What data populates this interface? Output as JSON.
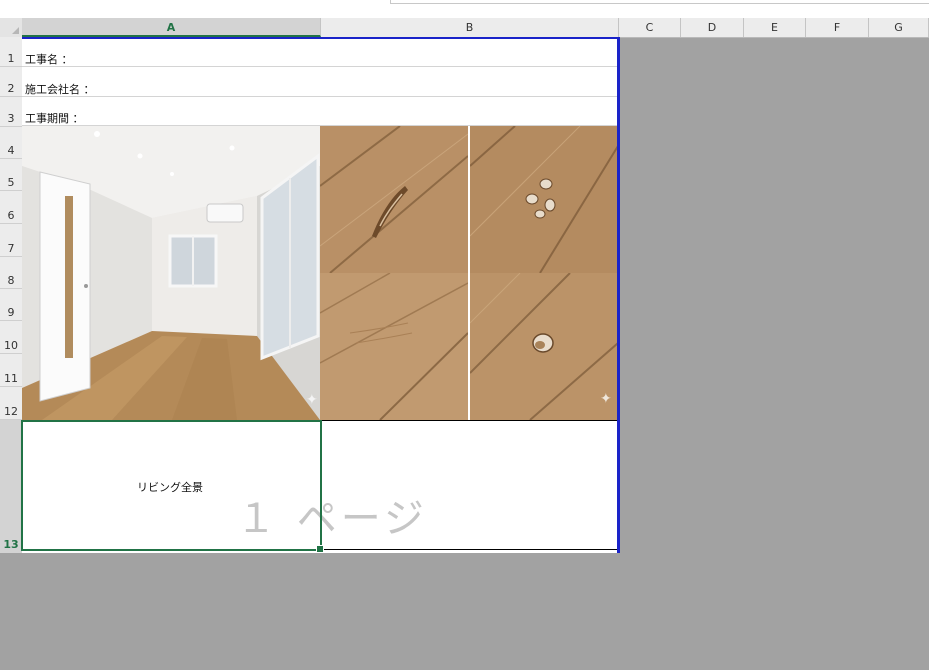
{
  "sheet": {
    "columns": [
      "A",
      "B",
      "C",
      "D",
      "E",
      "F",
      "G"
    ],
    "selected_column": "A",
    "rows": [
      "1",
      "2",
      "3",
      "4",
      "5",
      "6",
      "7",
      "8",
      "9",
      "10",
      "11",
      "12",
      "13"
    ],
    "selected_row": "13"
  },
  "cells": {
    "a1": "工事名 ：",
    "a2": "施工会社名 ：",
    "a3": "工事期間 ："
  },
  "photos": {
    "room": {
      "alt": "room-photo"
    },
    "damage_1": {
      "alt": "floor-scratch"
    },
    "damage_2": {
      "alt": "floor-dents"
    },
    "damage_3": {
      "alt": "floor-scuffs"
    },
    "damage_4": {
      "alt": "floor-dent"
    }
  },
  "captions": {
    "a13": "リビング全景"
  },
  "watermark": "１ ページ",
  "colors": {
    "selection": "#217346",
    "page_break": "#1a23c9",
    "outside_print_area": "#a2a2a2"
  }
}
